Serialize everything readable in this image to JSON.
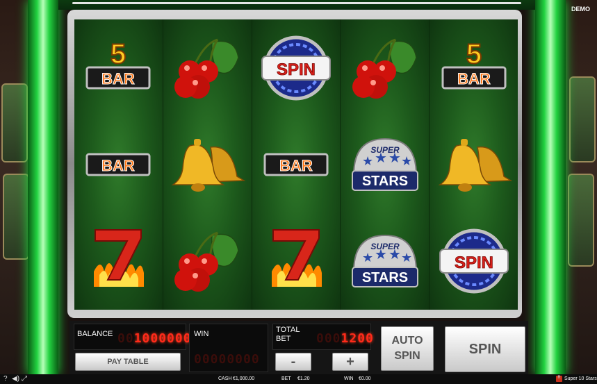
{
  "game": {
    "title": "Super 10 Stars",
    "mode_label": "DEMO"
  },
  "reels": [
    [
      "5bar",
      "bar",
      "seven"
    ],
    [
      "cherries",
      "bell",
      "cherries"
    ],
    [
      "spin",
      "bar",
      "seven"
    ],
    [
      "cherries",
      "superstars",
      "superstars"
    ],
    [
      "5bar",
      "bell",
      "spin"
    ]
  ],
  "symbols": {
    "five_bar": {
      "digit": "5",
      "text": "BAR"
    },
    "bar": {
      "text": "BAR"
    },
    "spin": {
      "text": "SPIN"
    },
    "superstars": {
      "top": "SUPER",
      "bottom": "STARS"
    }
  },
  "panel": {
    "balance_label": "BALANCE",
    "balance_dim": "00",
    "balance_value": "1000000",
    "win_label": "WIN",
    "win_value": "00000000",
    "total_bet_label_1": "TOTAL",
    "total_bet_label_2": "BET",
    "total_bet_dim": "000",
    "total_bet_value": "1200",
    "paytable_label": "PAY TABLE",
    "minus_label": "-",
    "plus_label": "+",
    "auto_spin_label_1": "AUTO",
    "auto_spin_label_2": "SPIN",
    "spin_label": "SPIN"
  },
  "status": {
    "cash_label": "CASH",
    "cash_value": "€1,000.00",
    "bet_label": "BET",
    "bet_value": "€1.20",
    "win_label": "WIN",
    "win_value": "€0.00",
    "help_icon": "?",
    "sound_icon": "speaker-icon",
    "settings_icon": "gear-icon",
    "fullscreen_icon": "fullscreen-icon"
  },
  "colors": {
    "neon_green": "#22d240",
    "lcd_red": "#ff2a1a",
    "reel_green": "#1d5a1c"
  }
}
